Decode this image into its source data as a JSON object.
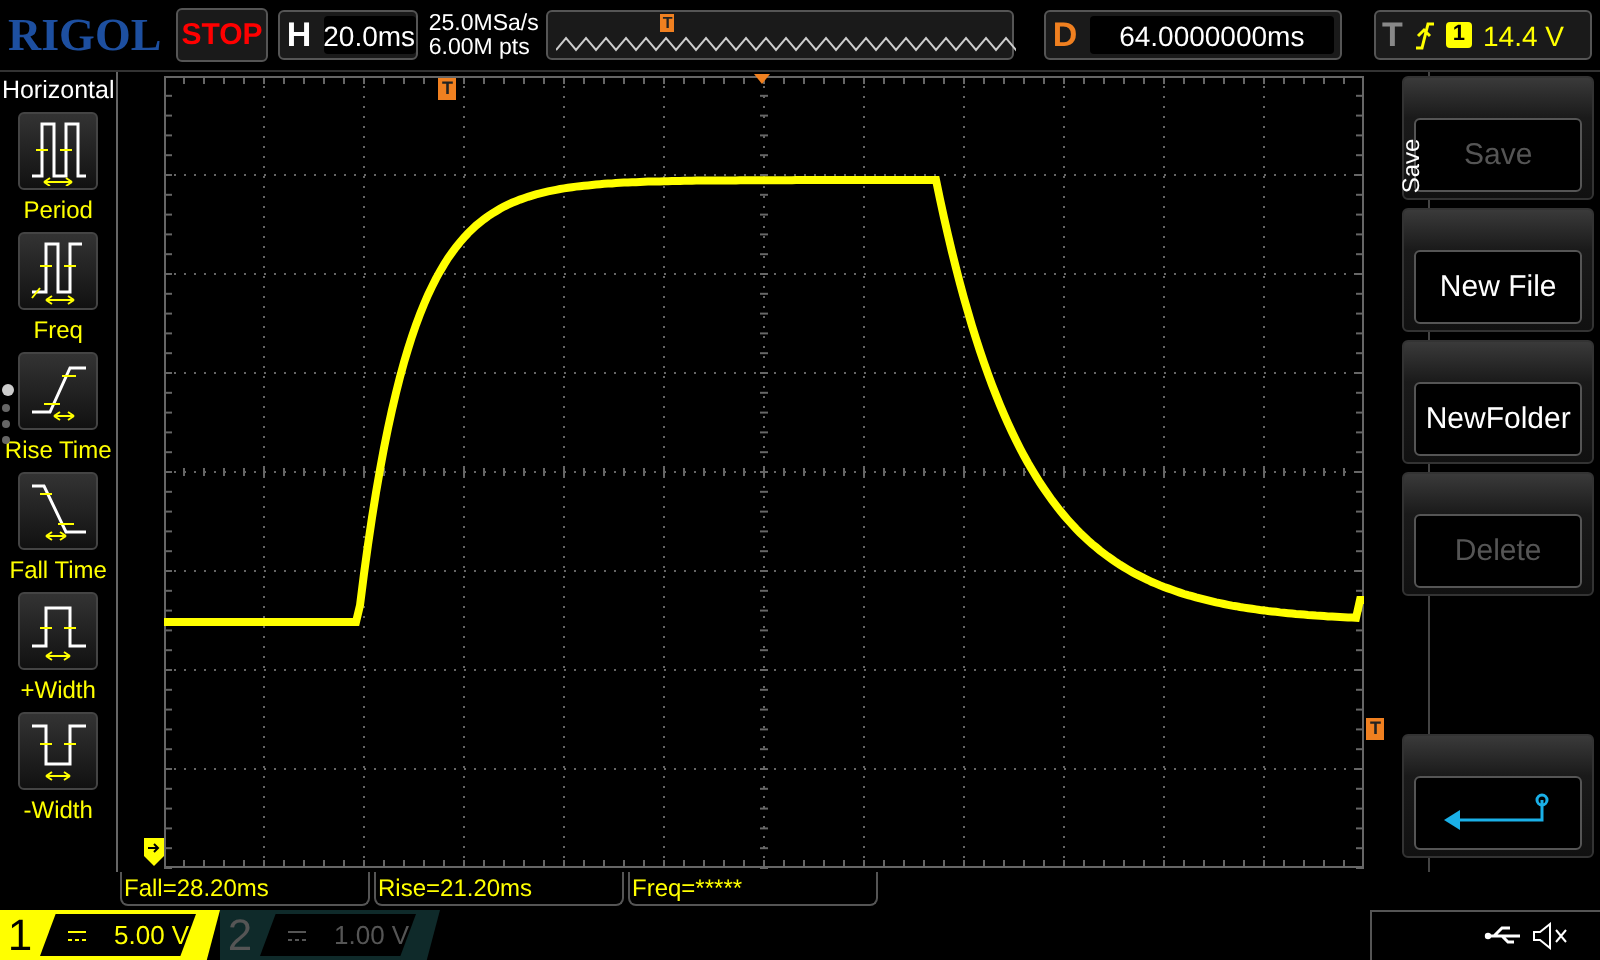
{
  "logo": "RIGOL",
  "run_state": "STOP",
  "timebase": {
    "label": "H",
    "value": "20.0ms"
  },
  "acquisition": {
    "sample_rate": "25.0MSa/s",
    "memory_depth": "6.00M pts",
    "trigger_marker": "T"
  },
  "delay": {
    "label": "D",
    "value": "64.0000000ms"
  },
  "trigger": {
    "label": "T",
    "source": "1",
    "level": "14.4 V"
  },
  "left_menu": {
    "title": "Horizontal",
    "pages": [
      {
        "selected": true
      },
      {
        "selected": false
      },
      {
        "selected": false
      },
      {
        "selected": false
      }
    ],
    "items": [
      {
        "kind": "period",
        "label": "Period"
      },
      {
        "kind": "freq",
        "label": "Freq"
      },
      {
        "kind": "rise",
        "label": "Rise Time"
      },
      {
        "kind": "fall",
        "label": "Fall Time"
      },
      {
        "kind": "pwidth",
        "label": "+Width"
      },
      {
        "kind": "nwidth",
        "label": "-Width"
      }
    ]
  },
  "screen": {
    "trigger_position_marker": "T",
    "trigger_level_marker": "T"
  },
  "right_menu": {
    "title": "Save",
    "buttons": [
      {
        "kind": "text",
        "label": "Save",
        "disabled": true
      },
      {
        "kind": "text",
        "label": "New File",
        "disabled": false
      },
      {
        "kind": "text",
        "label": "NewFolder",
        "disabled": false
      },
      {
        "kind": "text",
        "label": "Delete",
        "disabled": true
      },
      {
        "kind": "back"
      }
    ]
  },
  "measurements": [
    "Fall=28.20ms",
    "Rise=21.20ms",
    "Freq=*****"
  ],
  "channels": [
    {
      "number": "1",
      "scale": "5.00 V",
      "on": true
    },
    {
      "number": "2",
      "scale": "1.00 V",
      "on": false
    }
  ]
}
